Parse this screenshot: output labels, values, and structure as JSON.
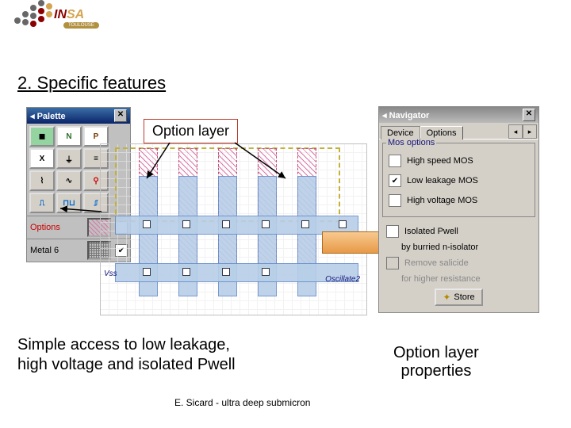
{
  "logo": {
    "brand1": "IN",
    "brand2": "SA",
    "sub": "TOULOUSE"
  },
  "heading": "2. Specific features",
  "option_layer_label": "Option layer",
  "palette": {
    "title": "Palette",
    "icons": [
      "",
      "N",
      "P",
      "X",
      "⏚",
      "≡",
      "⌇",
      "∿",
      "⚲",
      "⎍",
      "⊓⊔",
      "⎎"
    ],
    "row1_label": "Options",
    "row2_label": "Metal 6"
  },
  "navigator": {
    "title": "Navigator",
    "tabs": [
      "Device",
      "Options"
    ],
    "group1": {
      "label": "Mos options",
      "items": [
        {
          "label": "High speed MOS",
          "checked": false
        },
        {
          "label": "Low leakage MOS",
          "checked": true
        },
        {
          "label": "High voltage MOS",
          "checked": false
        }
      ]
    },
    "iso": {
      "label": "Isolated Pwell",
      "sub": "by burried n-isolator",
      "checked": false
    },
    "sal": {
      "label": "Remove salicide",
      "sub": "for higher resistance",
      "checked": false,
      "disabled": true
    },
    "store": "Store"
  },
  "diagram": {
    "vss": "Vss",
    "osc": "Oscillate2"
  },
  "summary": {
    "line1": "Simple access to low leakage,",
    "line2": "high voltage and isolated Pwell",
    "right1": "Option layer",
    "right2": "properties"
  },
  "footer": "E. Sicard - ultra deep submicron"
}
